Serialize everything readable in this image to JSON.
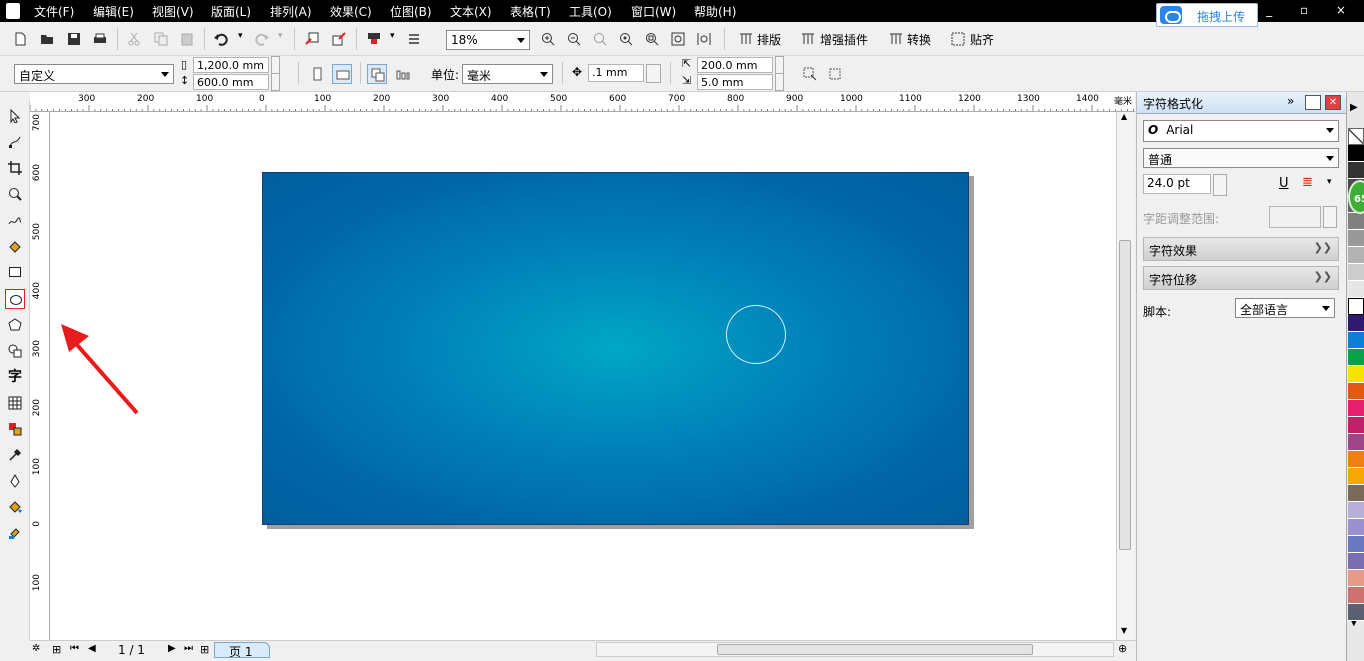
{
  "menu": [
    "文件(F)",
    "编辑(E)",
    "视图(V)",
    "版面(L)",
    "排列(A)",
    "效果(C)",
    "位图(B)",
    "文本(X)",
    "表格(T)",
    "工具(O)",
    "窗口(W)",
    "帮助(H)"
  ],
  "upload_label": "拖拽上传",
  "window_controls": "_ ▫ ×",
  "toolbar": {
    "zoom": "18%",
    "buttons": [
      "排版",
      "增强插件",
      "转换",
      "贴齐"
    ]
  },
  "property_bar": {
    "paper_preset": "自定义",
    "width": "1,200.0 mm",
    "height": "600.0 mm",
    "units_label": "单位:",
    "units": "毫米",
    "nudge": ".1 mm",
    "dup_x": "200.0 mm",
    "dup_y": "5.0 mm"
  },
  "ruler_top": {
    "ticks": [
      "300",
      "200",
      "100",
      "0",
      "100",
      "200",
      "300",
      "400",
      "500",
      "600",
      "700",
      "800",
      "900",
      "1000",
      "1100",
      "1200",
      "1300",
      "1400"
    ],
    "unit": "毫米"
  },
  "ruler_left": {
    "ticks": [
      "700",
      "600",
      "500",
      "400",
      "300",
      "200",
      "100",
      "0",
      "100"
    ]
  },
  "status": {
    "page_count": "1 / 1",
    "page_tab": "页 1"
  },
  "docker": {
    "title": "字符格式化",
    "font": "Arial",
    "style": "普通",
    "size": "24.0 pt",
    "kerning_label": "字距调整范围:",
    "groups": [
      "字符效果",
      "字符位移"
    ],
    "script_label": "脚本:",
    "script_value": "全部语言"
  },
  "badge": "65",
  "colors": {
    "accent": "#2c84e6",
    "arrow": "#e81c1c",
    "page_center": "#00a7c4",
    "page_edge": "#005e9e"
  },
  "palette": [
    "#ffffff",
    "#000000",
    "#333333",
    "#4d4d4d",
    "#666666",
    "#808080",
    "#999999",
    "#b3b3b3",
    "#cccccc",
    "#e6e6e6",
    "#ffffff",
    "#2e1a6e",
    "#0a7fd8",
    "#0aa04a",
    "#f5e400",
    "#e25a10",
    "#e4206e",
    "#c0206a",
    "#a04488",
    "#f07e10",
    "#f3a900",
    "#7a6a5a",
    "#b8b0d8",
    "#9a8fcf",
    "#6a78c0",
    "#7a6db0",
    "#e89a8a",
    "#d07070",
    "#5a6070"
  ],
  "tools": [
    "pick-tool",
    "shape-tool",
    "crop-tool",
    "zoom-tool",
    "freehand-tool",
    "smart-fill-tool",
    "rectangle-tool",
    "ellipse-tool",
    "polygon-tool",
    "basic-shapes-tool",
    "text-tool",
    "table-tool",
    "interactive-tool",
    "eyedropper-tool",
    "outline-tool",
    "fill-tool",
    "interactive-fill-tool"
  ]
}
